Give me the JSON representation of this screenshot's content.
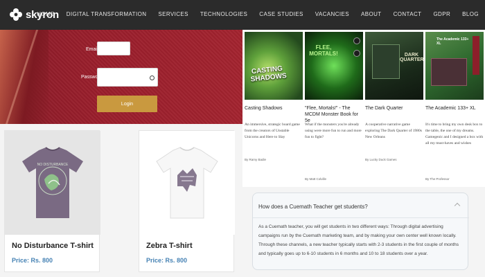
{
  "brand": {
    "name": "skyron"
  },
  "nav": {
    "items": [
      "HOME",
      "DIGITAL TRANSFORMATION",
      "SERVICES",
      "TECHNOLOGIES",
      "CASE STUDIES",
      "VACANCIES",
      "ABOUT",
      "CONTACT",
      "GDPR",
      "BLOG"
    ]
  },
  "login": {
    "email_label": "Email",
    "password_label": "Password",
    "button_label": "Login"
  },
  "products": [
    {
      "name": "No Disturbance T-shirt",
      "price": "Price: Rs. 800",
      "print": "NO DISTURBANCE"
    },
    {
      "name": "Zebra T-shirt",
      "price": "Price: Rs. 800"
    }
  ],
  "games": [
    {
      "title": "Casting Shadows",
      "art_title": "CASTING SHADOWS",
      "desc": "An immersive, strategic board game from the creators of Unstable Unicorns and Here to Slay",
      "author": "By Ramy Badie"
    },
    {
      "title": "\"Flee, Mortals!\" - The MCDM Monster Book for 5e",
      "art_title": "FLEE, MORTALS!",
      "desc": "What if the monsters you're already using were more fun to run and more fun to fight?",
      "author": "By Matt Colville"
    },
    {
      "title": "The Dark Quarter",
      "art_title": "DARK QUARTER",
      "desc": "A cooperative narrative game exploring The Dark Quarter of 1980s New Orleans",
      "author": "By Lucky Duck Games"
    },
    {
      "title": "The Academic 133+ XL",
      "art_title": "The Academic 133+ XL",
      "desc": "It's time to bring my own desk box to the table, the one of my dreams. Gamegenic and I designed a box with all my must-haves and wishes",
      "author": "By The Professor"
    }
  ],
  "faq": {
    "question": "How does a Cuemath Teacher get students?",
    "answer": "As a Cuemath teacher, you will get students in two different ways: Through digital advertising campaigns run by the Cuemath marketing team, and by making your own center well known locally. Through these channels, a new teacher typically starts with 2-3 students in the first couple of months and typically goes up to 6-10 students in 6 months and 10 to 18 students over a year."
  },
  "colors": {
    "nav_bg": "#2b2b2b",
    "hero_bg": "#9a1e2c",
    "login_button": "#c9993f",
    "price": "#4682b4"
  }
}
